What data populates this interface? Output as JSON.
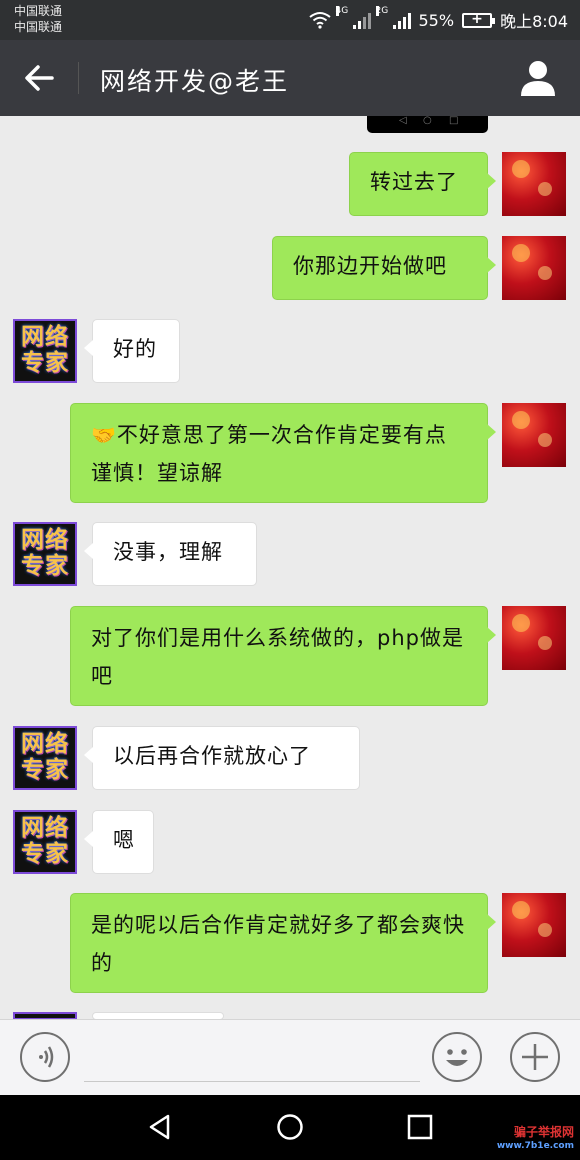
{
  "status_bar": {
    "carrier_1": "中国联通",
    "carrier_2": "中国联通",
    "net_1": "4G",
    "net_2": "2G",
    "battery_percent": "55%",
    "time": "晚上8:04"
  },
  "header": {
    "title": "网络开发@老王"
  },
  "contact_avatar_text": [
    "网络",
    "专家"
  ],
  "messages": [
    {
      "side": "right",
      "text": "转过去了"
    },
    {
      "side": "right",
      "text": "你那边开始做吧"
    },
    {
      "side": "left",
      "text": "好的"
    },
    {
      "side": "right",
      "text": "不好意思了第一次合作肯定要有点谨慎！望谅解"
    },
    {
      "side": "left",
      "text": "没事，理解"
    },
    {
      "side": "right",
      "text": "对了你们是用什么系统做的，php做是吧"
    },
    {
      "side": "left",
      "text": "以后再合作就放心了"
    },
    {
      "side": "left",
      "text": "嗯"
    },
    {
      "side": "right",
      "text": "是的呢以后合作肯定就好多了都会爽快的"
    }
  ],
  "watermark": {
    "text": "骗子举报网",
    "url": "www.7b1e.com"
  },
  "colors": {
    "nav_bg": "#393a3f",
    "status_bg": "#2f3133",
    "bubble_green": "#9fe85a",
    "chat_bg": "#ebebeb"
  }
}
